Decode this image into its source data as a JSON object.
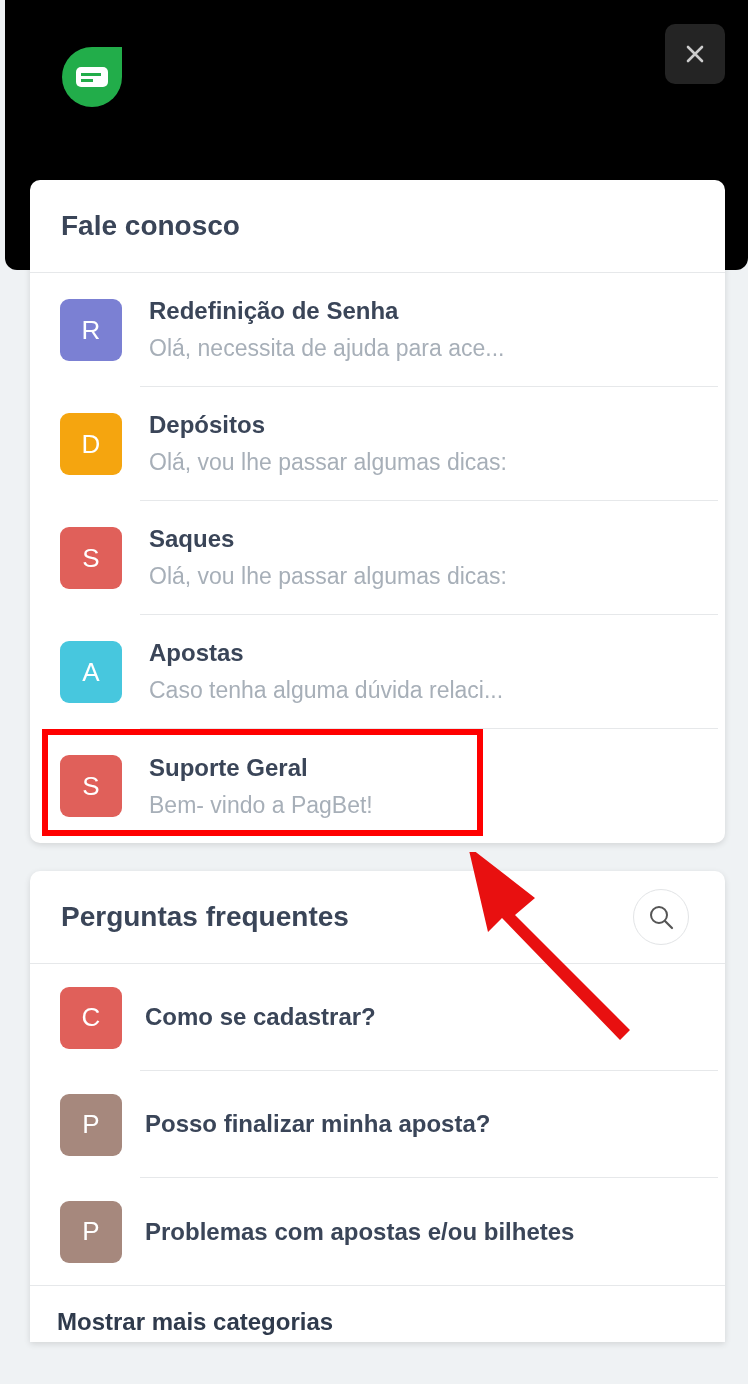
{
  "contact": {
    "title": "Fale conosco",
    "items": [
      {
        "initial": "R",
        "color": "#7b80d3",
        "title": "Redefinição de Senha",
        "preview": "Olá, necessita de ajuda para ace...",
        "highlighted": false
      },
      {
        "initial": "D",
        "color": "#f5a50f",
        "title": "Depósitos",
        "preview": "Olá, vou lhe passar algumas dicas:",
        "highlighted": false
      },
      {
        "initial": "S",
        "color": "#e0605a",
        "title": "Saques",
        "preview": "Olá, vou lhe passar algumas dicas:",
        "highlighted": false
      },
      {
        "initial": "A",
        "color": "#47c7de",
        "title": "Apostas",
        "preview": "Caso tenha alguma dúvida relaci...",
        "highlighted": false
      },
      {
        "initial": "S",
        "color": "#e0605a",
        "title": "Suporte Geral",
        "preview": "Bem- vindo a PagBet!",
        "highlighted": true
      }
    ]
  },
  "faq": {
    "title": "Perguntas frequentes",
    "items": [
      {
        "initial": "C",
        "color": "#e0605a",
        "title": "Como se cadastrar?"
      },
      {
        "initial": "P",
        "color": "#a6887d",
        "title": "Posso finalizar minha aposta?"
      },
      {
        "initial": "P",
        "color": "#a6887d",
        "title": "Problemas com apostas e/ou bilhetes"
      }
    ],
    "more": "Mostrar mais categorias"
  }
}
